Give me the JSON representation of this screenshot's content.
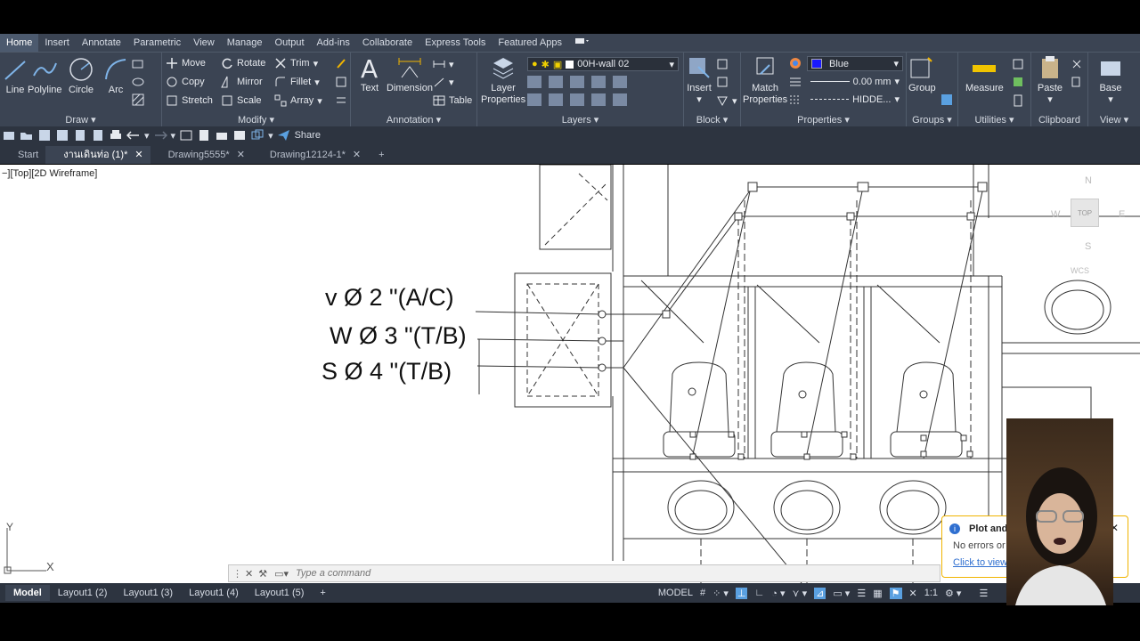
{
  "menu": {
    "tabs": [
      "Home",
      "Insert",
      "Annotate",
      "Parametric",
      "View",
      "Manage",
      "Output",
      "Add-ins",
      "Collaborate",
      "Express Tools",
      "Featured Apps"
    ]
  },
  "ribbon": {
    "draw": {
      "title": "Draw",
      "line": "Line",
      "polyline": "Polyline",
      "circle": "Circle",
      "arc": "Arc"
    },
    "modify": {
      "title": "Modify",
      "move": "Move",
      "rotate": "Rotate",
      "trim": "Trim",
      "copy": "Copy",
      "mirror": "Mirror",
      "fillet": "Fillet",
      "stretch": "Stretch",
      "scale": "Scale",
      "array": "Array"
    },
    "annotation": {
      "title": "Annotation",
      "text": "Text",
      "dimension": "Dimension",
      "table": "Table"
    },
    "layers": {
      "title": "Layers",
      "layer_properties_1": "Layer",
      "layer_properties_2": "Properties",
      "current_layer": "00H-wall 02"
    },
    "block": {
      "title": "Block",
      "insert": "Insert"
    },
    "properties": {
      "title": "Properties",
      "match_1": "Match",
      "match_2": "Properties",
      "color": "Blue",
      "color_hex": "#1a1aff",
      "lineweight": "0.00 mm",
      "linetype": "HIDDE..."
    },
    "groups": {
      "title": "Groups",
      "group": "Group"
    },
    "utilities": {
      "title": "Utilities",
      "measure": "Measure"
    },
    "clipboard": {
      "title": "Clipboard",
      "paste": "Paste"
    },
    "view": {
      "title": "View",
      "base": "Base"
    }
  },
  "qat": {
    "share": "Share"
  },
  "doctabs": {
    "start": "Start",
    "tab1": "งานเดินท่อ (1)*",
    "tab2": "Drawing5555*",
    "tab3": "Drawing12124-1*"
  },
  "viewport": {
    "label": "−][Top][2D Wireframe]",
    "annotations": {
      "vent": "v Ø 2 \"(A/C)",
      "water": "W Ø 3 \"(T/B)",
      "sewer": "S Ø 4 \"(T/B)"
    },
    "viewcube": {
      "n": "N",
      "s": "S",
      "e": "E",
      "w": "W",
      "top": "TOP",
      "wcs": "WCS"
    },
    "ucs": {
      "x": "X",
      "y": "Y"
    }
  },
  "command": {
    "placeholder": "Type a command"
  },
  "layouts": {
    "model": "Model",
    "l2": "Layout1 (2)",
    "l3": "Layout1 (3)",
    "l4": "Layout1 (4)",
    "l5": "Layout1 (5)"
  },
  "status": {
    "model": "MODEL",
    "scale": "1:1"
  },
  "notification": {
    "title": "Plot and",
    "line1": "No errors or w",
    "link": "Click to view"
  }
}
